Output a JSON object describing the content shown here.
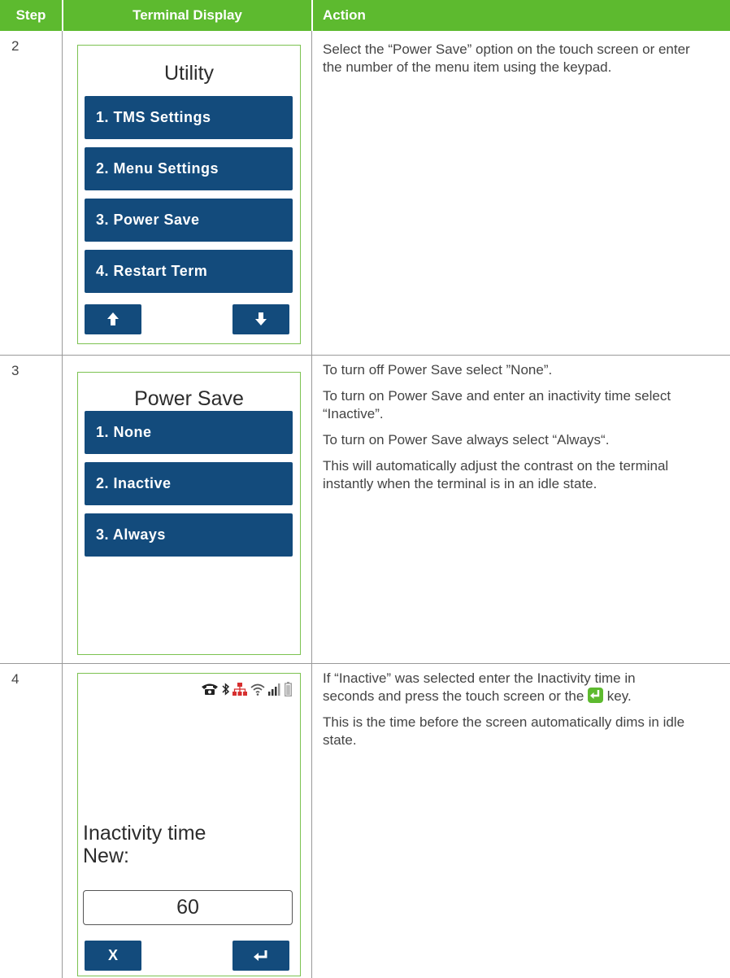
{
  "header": {
    "step_col": "Step",
    "display_col": "Terminal Display",
    "action_col": "Action"
  },
  "rows": [
    {
      "step": "2",
      "screen": {
        "title": "Utility",
        "items": [
          "1. TMS Settings",
          "2. Menu Settings",
          "3. Power Save",
          "4. Restart Term"
        ],
        "up_icon": "arrow-up-icon",
        "down_icon": "arrow-down-icon"
      },
      "action": [
        "Select the “Power Save” option on the touch screen or enter the number of the menu item using the keypad."
      ]
    },
    {
      "step": "3",
      "screen": {
        "title": "Power Save",
        "items": [
          "1. None",
          "2. Inactive",
          "3. Always"
        ]
      },
      "action": [
        "To turn off Power Save select ”None”.",
        "To turn on Power Save and enter an inactivity time select “Inactive”.",
        "To turn on Power Save always select “Always“.",
        "This will automatically adjust the contrast on the terminal instantly when the terminal is in an idle state."
      ]
    },
    {
      "step": "4",
      "screen": {
        "status_icons": [
          "phone-icon",
          "bluetooth-icon",
          "network-icon",
          "wifi-icon",
          "signal-icon",
          "battery-icon"
        ],
        "prompt_line1": "Inactivity time",
        "prompt_line2": "New:",
        "input_value": "60",
        "cancel_label": "X",
        "enter_icon": "enter-icon"
      },
      "action": {
        "p1_before": "If “Inactive” was selected enter the Inactivity time in seconds and press the touch screen or the",
        "p1_after": "key.",
        "p2": "This is the time before the screen automatically dims in idle state."
      }
    }
  ],
  "colors": {
    "header_green": "#5dba2f",
    "button_navy": "#134b7c",
    "screen_border": "#7cc251",
    "network_red": "#d62f2f"
  }
}
